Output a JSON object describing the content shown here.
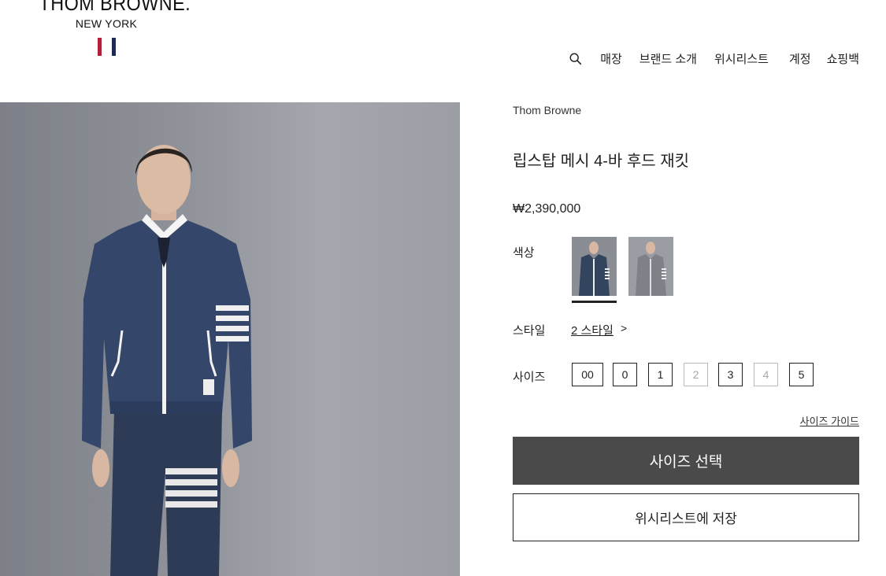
{
  "header": {
    "logo_main": "THOM BROWNE.",
    "logo_sub": "NEW YORK",
    "flag_colors": [
      "#b0223a",
      "#ffffff",
      "#1e2a55"
    ],
    "nav": {
      "search_icon": "search-icon",
      "items": [
        "매장",
        "브랜드 소개",
        "위시리스트",
        "계정",
        "쇼핑백"
      ]
    }
  },
  "product": {
    "brand": "Thom Browne",
    "title": "립스탑 메시 4-바 후드 재킷",
    "price": "₩2,390,000",
    "color_label": "색상",
    "colors": [
      {
        "name": "navy",
        "hex": "#2f3e5c",
        "selected": true
      },
      {
        "name": "grey",
        "hex": "#8a8d92",
        "selected": false
      }
    ],
    "style_label": "스타일",
    "style_link": "2 스타일",
    "style_arrow": ">",
    "size_label": "사이즈",
    "sizes": [
      {
        "label": "00",
        "available": true
      },
      {
        "label": "0",
        "available": true
      },
      {
        "label": "1",
        "available": true
      },
      {
        "label": "2",
        "available": false
      },
      {
        "label": "3",
        "available": true
      },
      {
        "label": "4",
        "available": false
      },
      {
        "label": "5",
        "available": true
      }
    ],
    "size_guide": "사이즈 가이드",
    "select_size_button": "사이즈 선택",
    "wishlist_button": "위시리스트에 저장"
  }
}
